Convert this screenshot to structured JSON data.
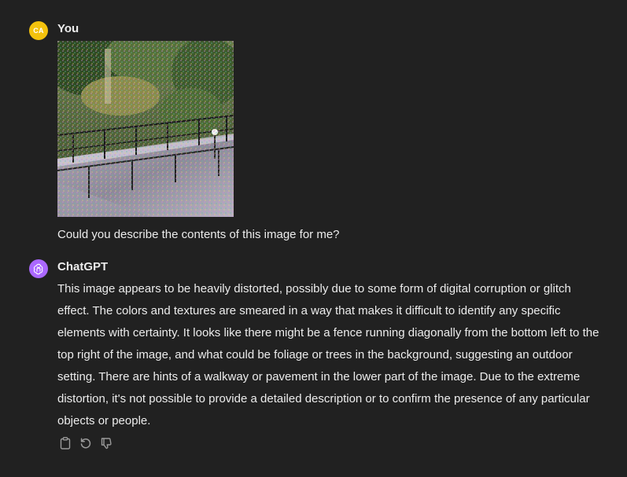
{
  "user_message": {
    "avatar_initials": "CA",
    "author": "You",
    "image_subject": "glitched photo of a walkway with railing and trees",
    "text": "Could you describe the contents of this image for me?"
  },
  "assistant_message": {
    "author": "ChatGPT",
    "avatar_icon": "openai-logo-icon",
    "text": "This image appears to be heavily distorted, possibly due to some form of digital corruption or glitch effect. The colors and textures are smeared in a way that makes it difficult to identify any specific elements with certainty. It looks like there might be a fence running diagonally from the bottom left to the top right of the image, and what could be foliage or trees in the background, suggesting an outdoor setting. There are hints of a walkway or pavement in the lower part of the image. Due to the extreme distortion, it's not possible to provide a detailed description or to confirm the presence of any particular objects or people."
  },
  "actions": {
    "icons": [
      "copy-icon",
      "regenerate-icon",
      "thumbs-down-icon"
    ]
  },
  "colors": {
    "background": "#212121",
    "text": "#ececec",
    "muted_icon": "#9b9b9b",
    "user_avatar": "#f4c20d",
    "assistant_avatar": "#ab68ff"
  }
}
